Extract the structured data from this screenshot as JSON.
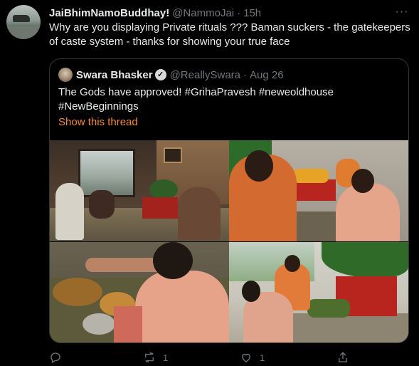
{
  "tweet": {
    "author_name": "JaiBhimNamoBuddhay!",
    "author_handle": "@NammoJai",
    "separator": "·",
    "time": "15h",
    "more_label": "···",
    "text": "Why are you displaying Private rituals ??? Baman suckers - the gatekeepers of caste system - thanks for showing your true face"
  },
  "quoted": {
    "author_name": "Swara Bhasker",
    "verified_glyph": "✓",
    "author_handle": "@ReallySwara",
    "separator": "·",
    "time": "Aug 26",
    "text_line1": "The Gods have approved! #GrihaPravesh #neweoldhouse",
    "text_line2": "#NewBeginnings",
    "show_thread": "Show this thread"
  },
  "actions": {
    "reply_count": "",
    "retweet_count": "1",
    "like_count": "1",
    "share_label": ""
  },
  "colors": {
    "background": "#000000",
    "text": "#e7e9ea",
    "muted": "#71767b",
    "accent": "#f08a3c",
    "border": "#2f3336"
  },
  "icons": [
    "more-icon",
    "verified-icon",
    "reply-icon",
    "retweet-icon",
    "like-icon",
    "share-icon"
  ]
}
